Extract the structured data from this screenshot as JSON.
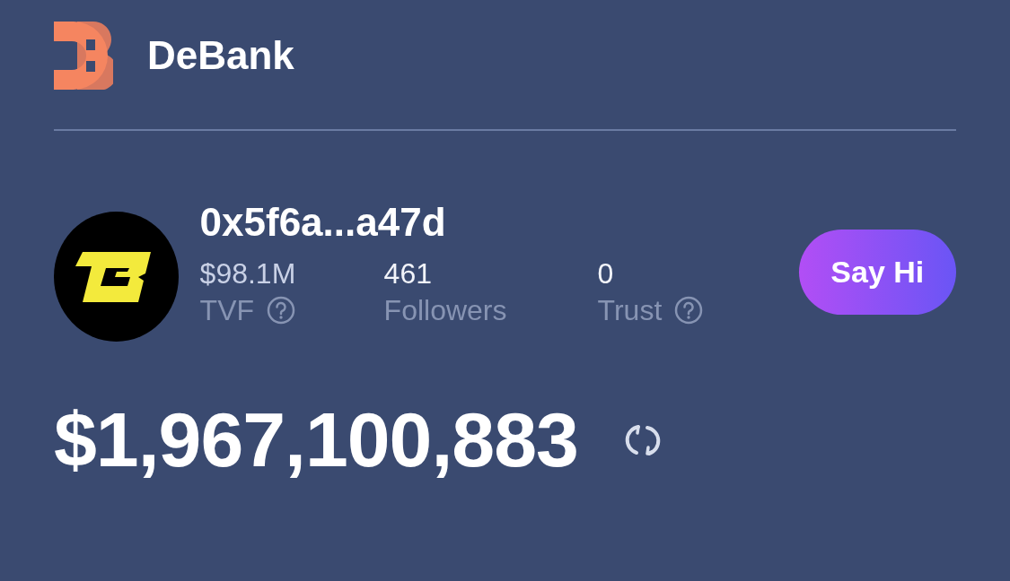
{
  "brand": {
    "name": "DeBank"
  },
  "profile": {
    "address": "0x5f6a...a47d",
    "stats": [
      {
        "value": "$98.1M",
        "label": "TVF",
        "help": true
      },
      {
        "value": "461",
        "label": "Followers",
        "help": false
      },
      {
        "value": "0",
        "label": "Trust",
        "help": true
      }
    ],
    "action": "Say Hi"
  },
  "balance": "$1,967,100,883"
}
